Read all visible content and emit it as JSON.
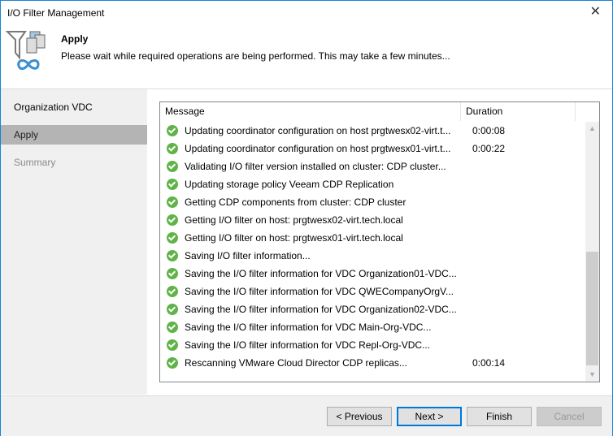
{
  "window": {
    "title": "I/O Filter Management"
  },
  "header": {
    "title": "Apply",
    "subtitle": "Please wait while required operations are being performed. This may take a few minutes..."
  },
  "nav": [
    {
      "label": "Organization VDC"
    },
    {
      "label": "Apply"
    },
    {
      "label": "Summary"
    }
  ],
  "grid": {
    "columns": [
      "Message",
      "Duration"
    ],
    "rows": [
      {
        "message": "Updating coordinator configuration on host prgtwesx02-virt.t...",
        "duration": "0:00:08"
      },
      {
        "message": "Updating coordinator configuration on host prgtwesx01-virt.t...",
        "duration": "0:00:22"
      },
      {
        "message": "Validating I/O filter version installed on cluster: CDP cluster...",
        "duration": ""
      },
      {
        "message": "Updating storage policy Veeam CDP Replication",
        "duration": ""
      },
      {
        "message": "Getting CDP components from cluster: CDP cluster",
        "duration": ""
      },
      {
        "message": "Getting I/O filter on host: prgtwesx02-virt.tech.local",
        "duration": ""
      },
      {
        "message": "Getting I/O filter on host: prgtwesx01-virt.tech.local",
        "duration": ""
      },
      {
        "message": "Saving I/O filter information...",
        "duration": ""
      },
      {
        "message": "Saving the I/O filter information for VDC Organization01-VDC...",
        "duration": ""
      },
      {
        "message": "Saving the I/O filter information for VDC QWECompanyOrgV...",
        "duration": ""
      },
      {
        "message": "Saving the I/O filter information for VDC Organization02-VDC...",
        "duration": ""
      },
      {
        "message": "Saving the I/O filter information for VDC Main-Org-VDC...",
        "duration": ""
      },
      {
        "message": "Saving the I/O filter information for VDC Repl-Org-VDC...",
        "duration": ""
      },
      {
        "message": "Rescanning VMware Cloud Director CDP replicas...",
        "duration": "0:00:14"
      }
    ]
  },
  "buttons": {
    "previous": "< Previous",
    "next": "Next >",
    "finish": "Finish",
    "cancel": "Cancel"
  }
}
